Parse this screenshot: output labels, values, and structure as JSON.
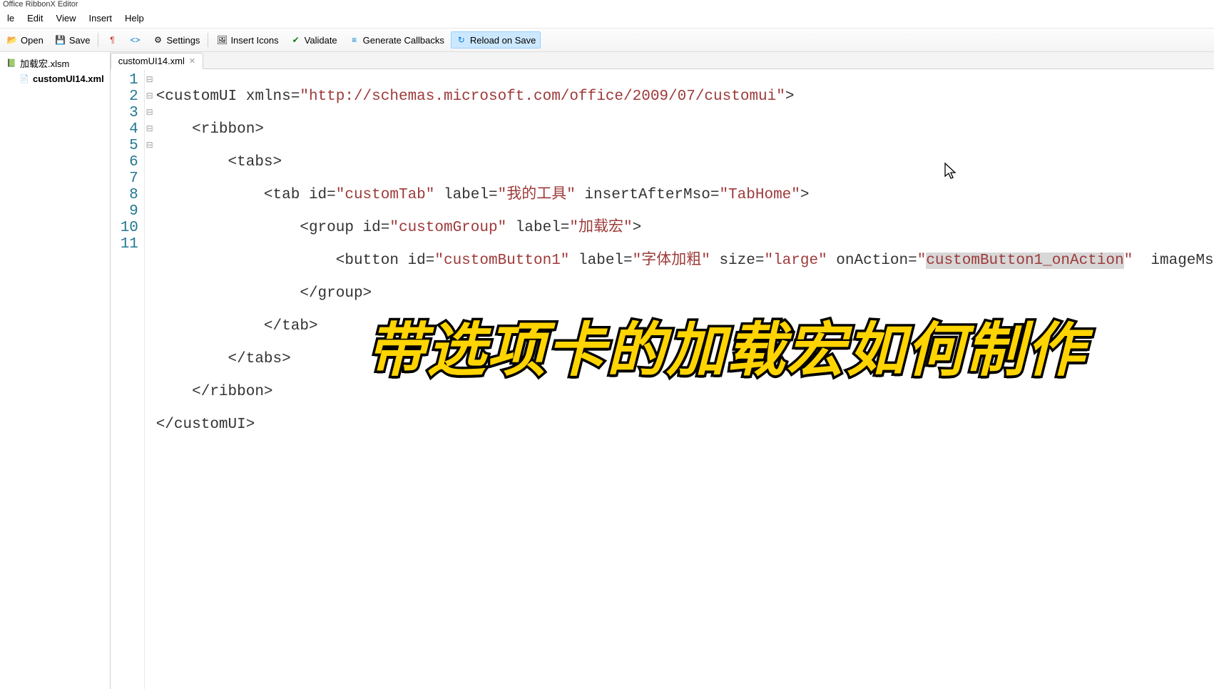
{
  "title": "Office RibbonX Editor",
  "menus": [
    "le",
    "Edit",
    "View",
    "Insert",
    "Help"
  ],
  "toolbar": {
    "open": "Open",
    "save": "Save",
    "settings": "Settings",
    "insert_icons": "Insert Icons",
    "validate": "Validate",
    "generate_callbacks": "Generate Callbacks",
    "reload": "Reload on Save"
  },
  "tree": {
    "root": "加载宏.xlsm",
    "child": "customUI14.xml"
  },
  "tab": {
    "label": "customUI14.xml"
  },
  "line_numbers": [
    "1",
    "2",
    "3",
    "4",
    "5",
    "6",
    "7",
    "8",
    "9",
    "10",
    "11"
  ],
  "fold_markers": [
    "⊟",
    "⊟",
    "⊟",
    "⊟",
    "⊟",
    "",
    "",
    "",
    "",
    "",
    ""
  ],
  "code": {
    "line1": {
      "pre": "<customUI xmlns=",
      "str": "\"http://schemas.microsoft.com/office/2009/07/customui\"",
      "post": ">"
    },
    "line2": "    <ribbon>",
    "line3": "        <tabs>",
    "line4": {
      "pre": "            <tab id=",
      "s1": "\"customTab\"",
      "mid1": " label=",
      "s2": "\"我的工具\"",
      "mid2": " insertAfterMso=",
      "s3": "\"TabHome\"",
      "post": ">"
    },
    "line5": {
      "pre": "                <group id=",
      "s1": "\"customGroup\"",
      "mid1": " label=",
      "s2": "\"加载宏\"",
      "post": ">"
    },
    "line6": {
      "pre": "                    <button id=",
      "s1": "\"customButton1\"",
      "mid1": " label=",
      "s2": "\"字体加粗\"",
      "mid2": " size=",
      "s3": "\"large\"",
      "mid3": " onAction=",
      "q1": "\"",
      "sel": "customButton1_onAction",
      "q2": "\"",
      "mid4": "  imageMso"
    },
    "line7": "                </group>",
    "line8": "            </tab>",
    "line9": "        </tabs>",
    "line10": "    </ribbon>",
    "line11": "</customUI>"
  },
  "overlay": "带选项卡的加载宏如何制作"
}
